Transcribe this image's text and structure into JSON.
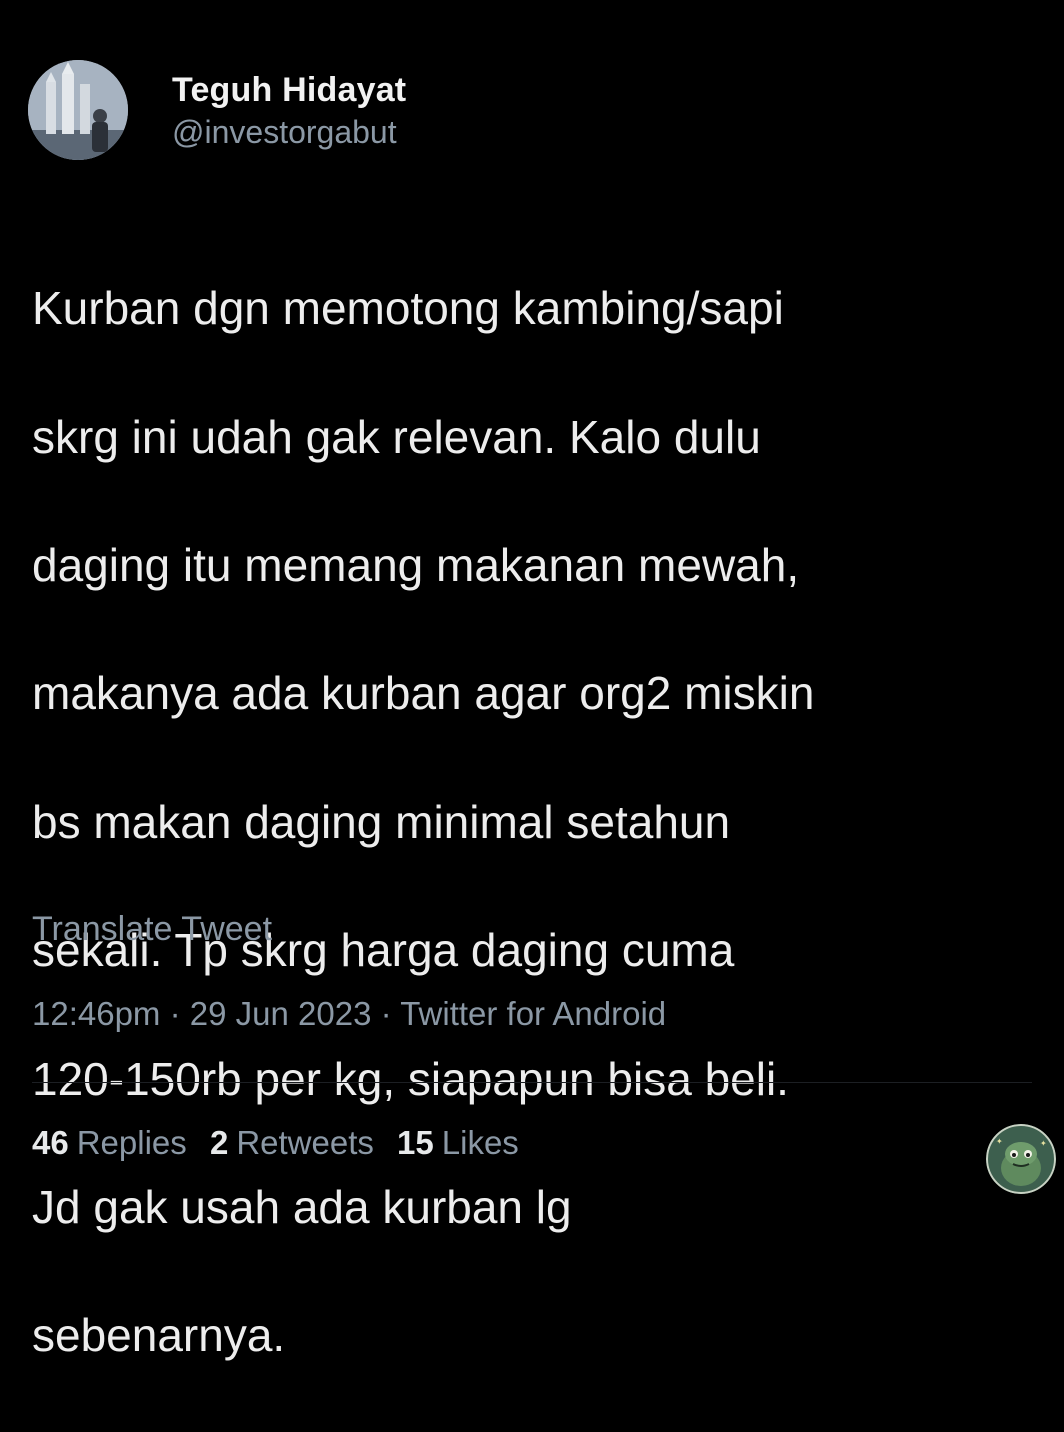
{
  "tweet": {
    "display_name": "Teguh Hidayat",
    "handle": "@investorgabut",
    "text_lines": [
      "Kurban dgn memotong kambing/sapi",
      "skrg ini udah gak relevan. Kalo dulu",
      "daging itu memang makanan mewah,",
      "makanya ada kurban agar org2 miskin",
      "bs makan daging minimal setahun",
      "sekali. Tp skrg harga daging cuma",
      "120-150rb per kg, siapapun bisa beli.",
      "Jd gak usah ada kurban lg",
      "sebenarnya."
    ],
    "translate_label": "Translate Tweet",
    "time": "12:46pm",
    "date": "29 Jun 2023",
    "source": "Twitter for Android",
    "separator": "·",
    "stats": {
      "replies_count": "46",
      "replies_label": "Replies",
      "retweets_count": "2",
      "retweets_label": "Retweets",
      "likes_count": "15",
      "likes_label": "Likes"
    }
  },
  "colors": {
    "background": "#000000",
    "text": "#ededed",
    "secondary_text": "#8b98a5"
  },
  "icons": {
    "avatar": "profile-photo-avatar",
    "watermark": "frog-mascot-watermark-icon"
  }
}
